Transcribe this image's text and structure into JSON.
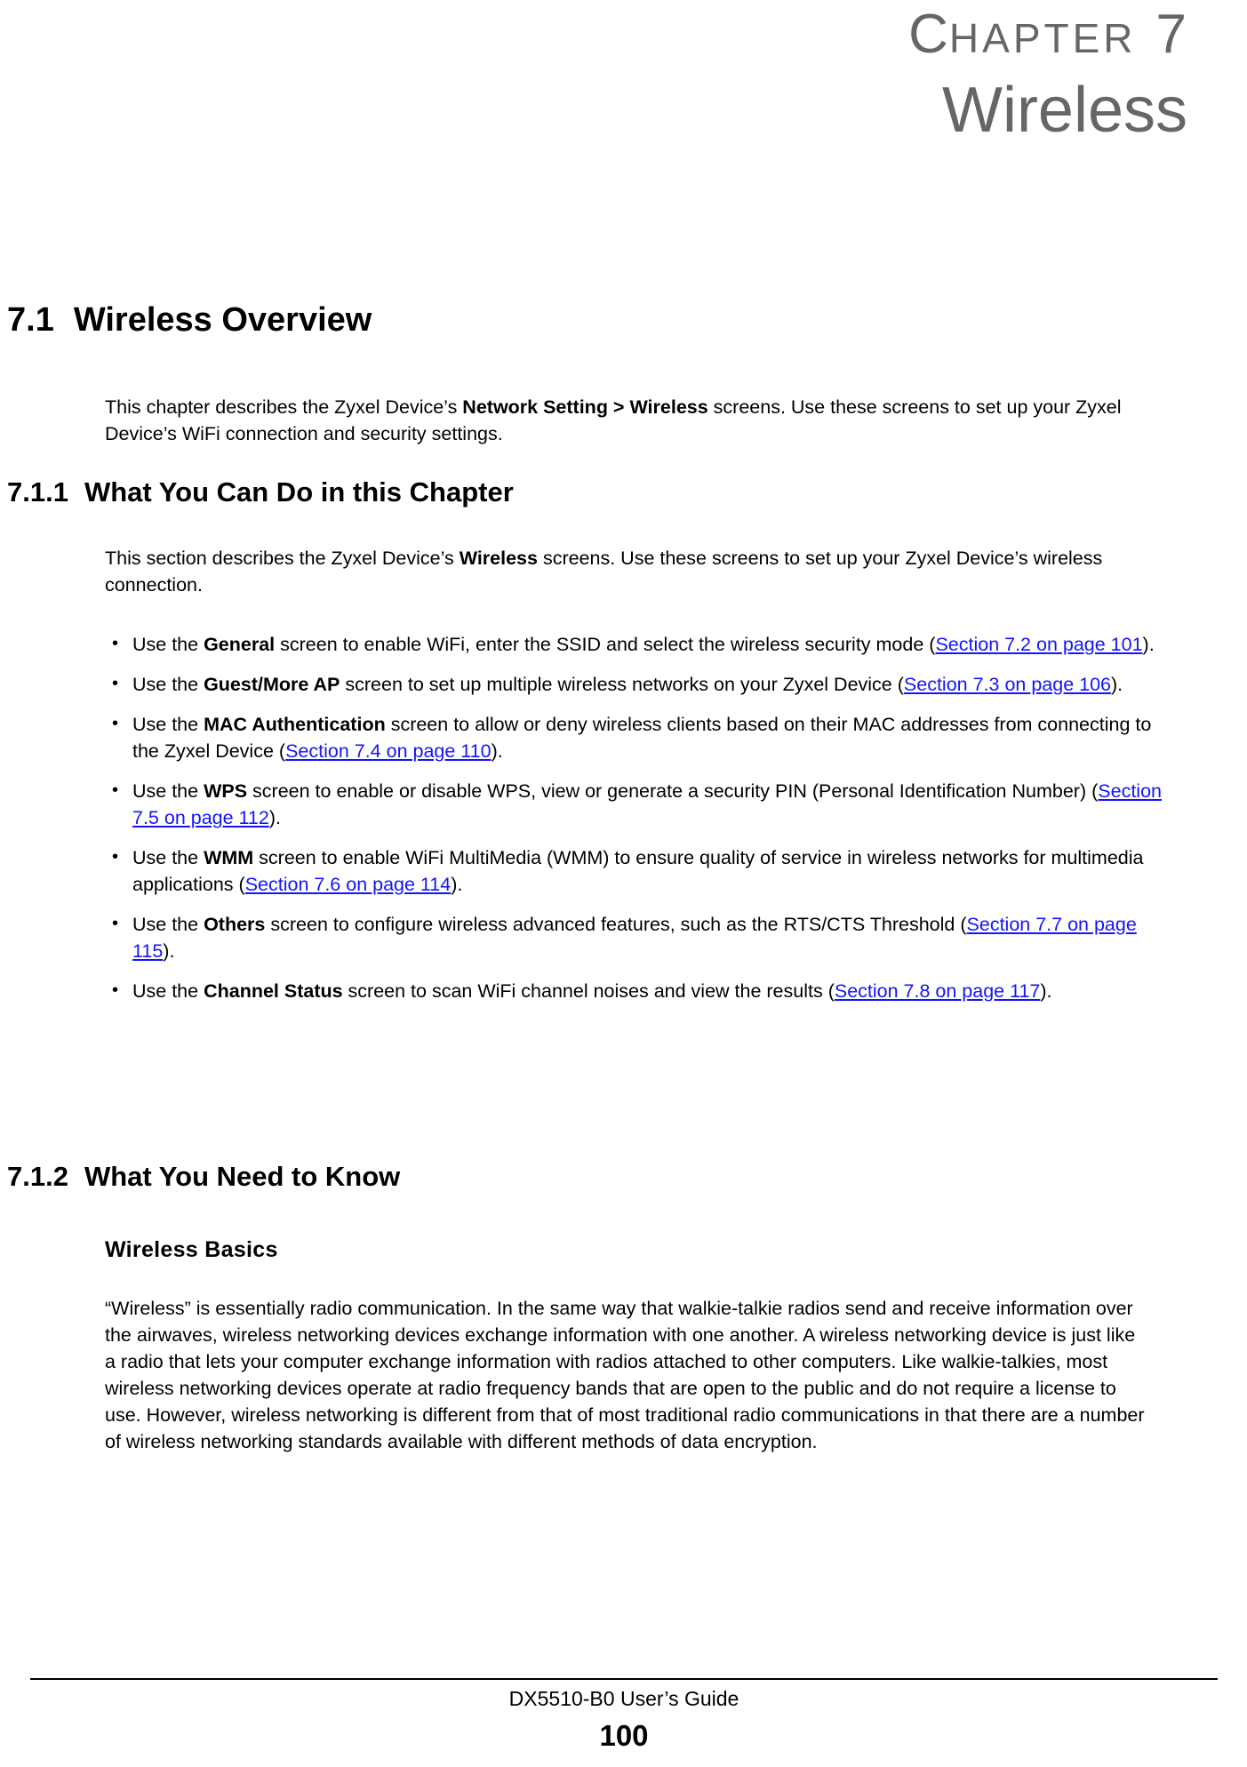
{
  "chapter": {
    "label_c": "C",
    "label_rest": "HAPTER",
    "number": "7",
    "title": "Wireless"
  },
  "sections": {
    "s71": {
      "number": "7.1",
      "title": "Wireless Overview",
      "para_1": "This chapter describes the Zyxel Device’s ",
      "para_1_bold": "Network Setting > Wireless",
      "para_1_tail": " screens. Use these screens to set up your Zyxel Device’s WiFi connection and security settings."
    },
    "s711": {
      "number": "7.1.1",
      "title": "What You Can Do in this Chapter",
      "para_1": "This section describes the Zyxel Device’s ",
      "para_1_bold": "Wireless",
      "para_1_tail": " screens. Use these screens to set up your Zyxel Device’s wireless connection.",
      "bullets": [
        {
          "pre": "Use the ",
          "bold": "General",
          "mid": " screen to enable WiFi, enter the SSID and select the wireless security mode (",
          "link": "Section 7.2 on page 101",
          "post": ")."
        },
        {
          "pre": "Use the ",
          "bold": "Guest/More AP",
          "mid": " screen to set up multiple wireless networks on your Zyxel Device (",
          "link": "Section 7.3 on page 106",
          "post": ")."
        },
        {
          "pre": "Use the ",
          "bold": "MAC Authentication",
          "mid": " screen to allow or deny wireless clients based on their MAC addresses from connecting to the Zyxel Device (",
          "link": "Section 7.4 on page 110",
          "post": ")."
        },
        {
          "pre": "Use the ",
          "bold": "WPS",
          "mid": " screen to enable or disable WPS, view or generate a security PIN (Personal Identification Number) (",
          "link": "Section 7.5 on page 112",
          "post": ")."
        },
        {
          "pre": "Use the ",
          "bold": "WMM",
          "mid": " screen to enable WiFi MultiMedia (WMM) to ensure quality of service in wireless networks for multimedia applications (",
          "link": "Section 7.6 on page 114",
          "post": ")."
        },
        {
          "pre": "Use the ",
          "bold": "Others",
          "mid": " screen to configure wireless advanced features, such as the RTS/CTS Threshold (",
          "link": "Section 7.7 on page 115",
          "post": ")."
        },
        {
          "pre": "Use the ",
          "bold": "Channel Status",
          "mid": " screen to scan WiFi channel noises and view the results (",
          "link": "Section 7.8 on page 117",
          "post": ")."
        }
      ]
    },
    "s712": {
      "number": "7.1.2",
      "title": "What You Need to Know",
      "minor_heading": "Wireless Basics",
      "para_1": "“Wireless” is essentially radio communication. In the same way that walkie-talkie radios send and receive information over the airwaves, wireless networking devices exchange information with one another. A wireless networking device is just like a radio that lets your computer exchange information with radios attached to other computers. Like walkie-talkies, most wireless networking devices operate at radio frequency bands that are open to the public and do not require a license to use. However, wireless networking is different from that of most traditional radio communications in that there are a number of wireless networking standards available with different methods of data encryption."
    }
  },
  "footer": {
    "guide": "DX5510-B0 User’s Guide",
    "page_number": "100"
  },
  "colors": {
    "chapter_gray": "#666666",
    "link_blue": "#1414ff",
    "text_black": "#000000"
  }
}
